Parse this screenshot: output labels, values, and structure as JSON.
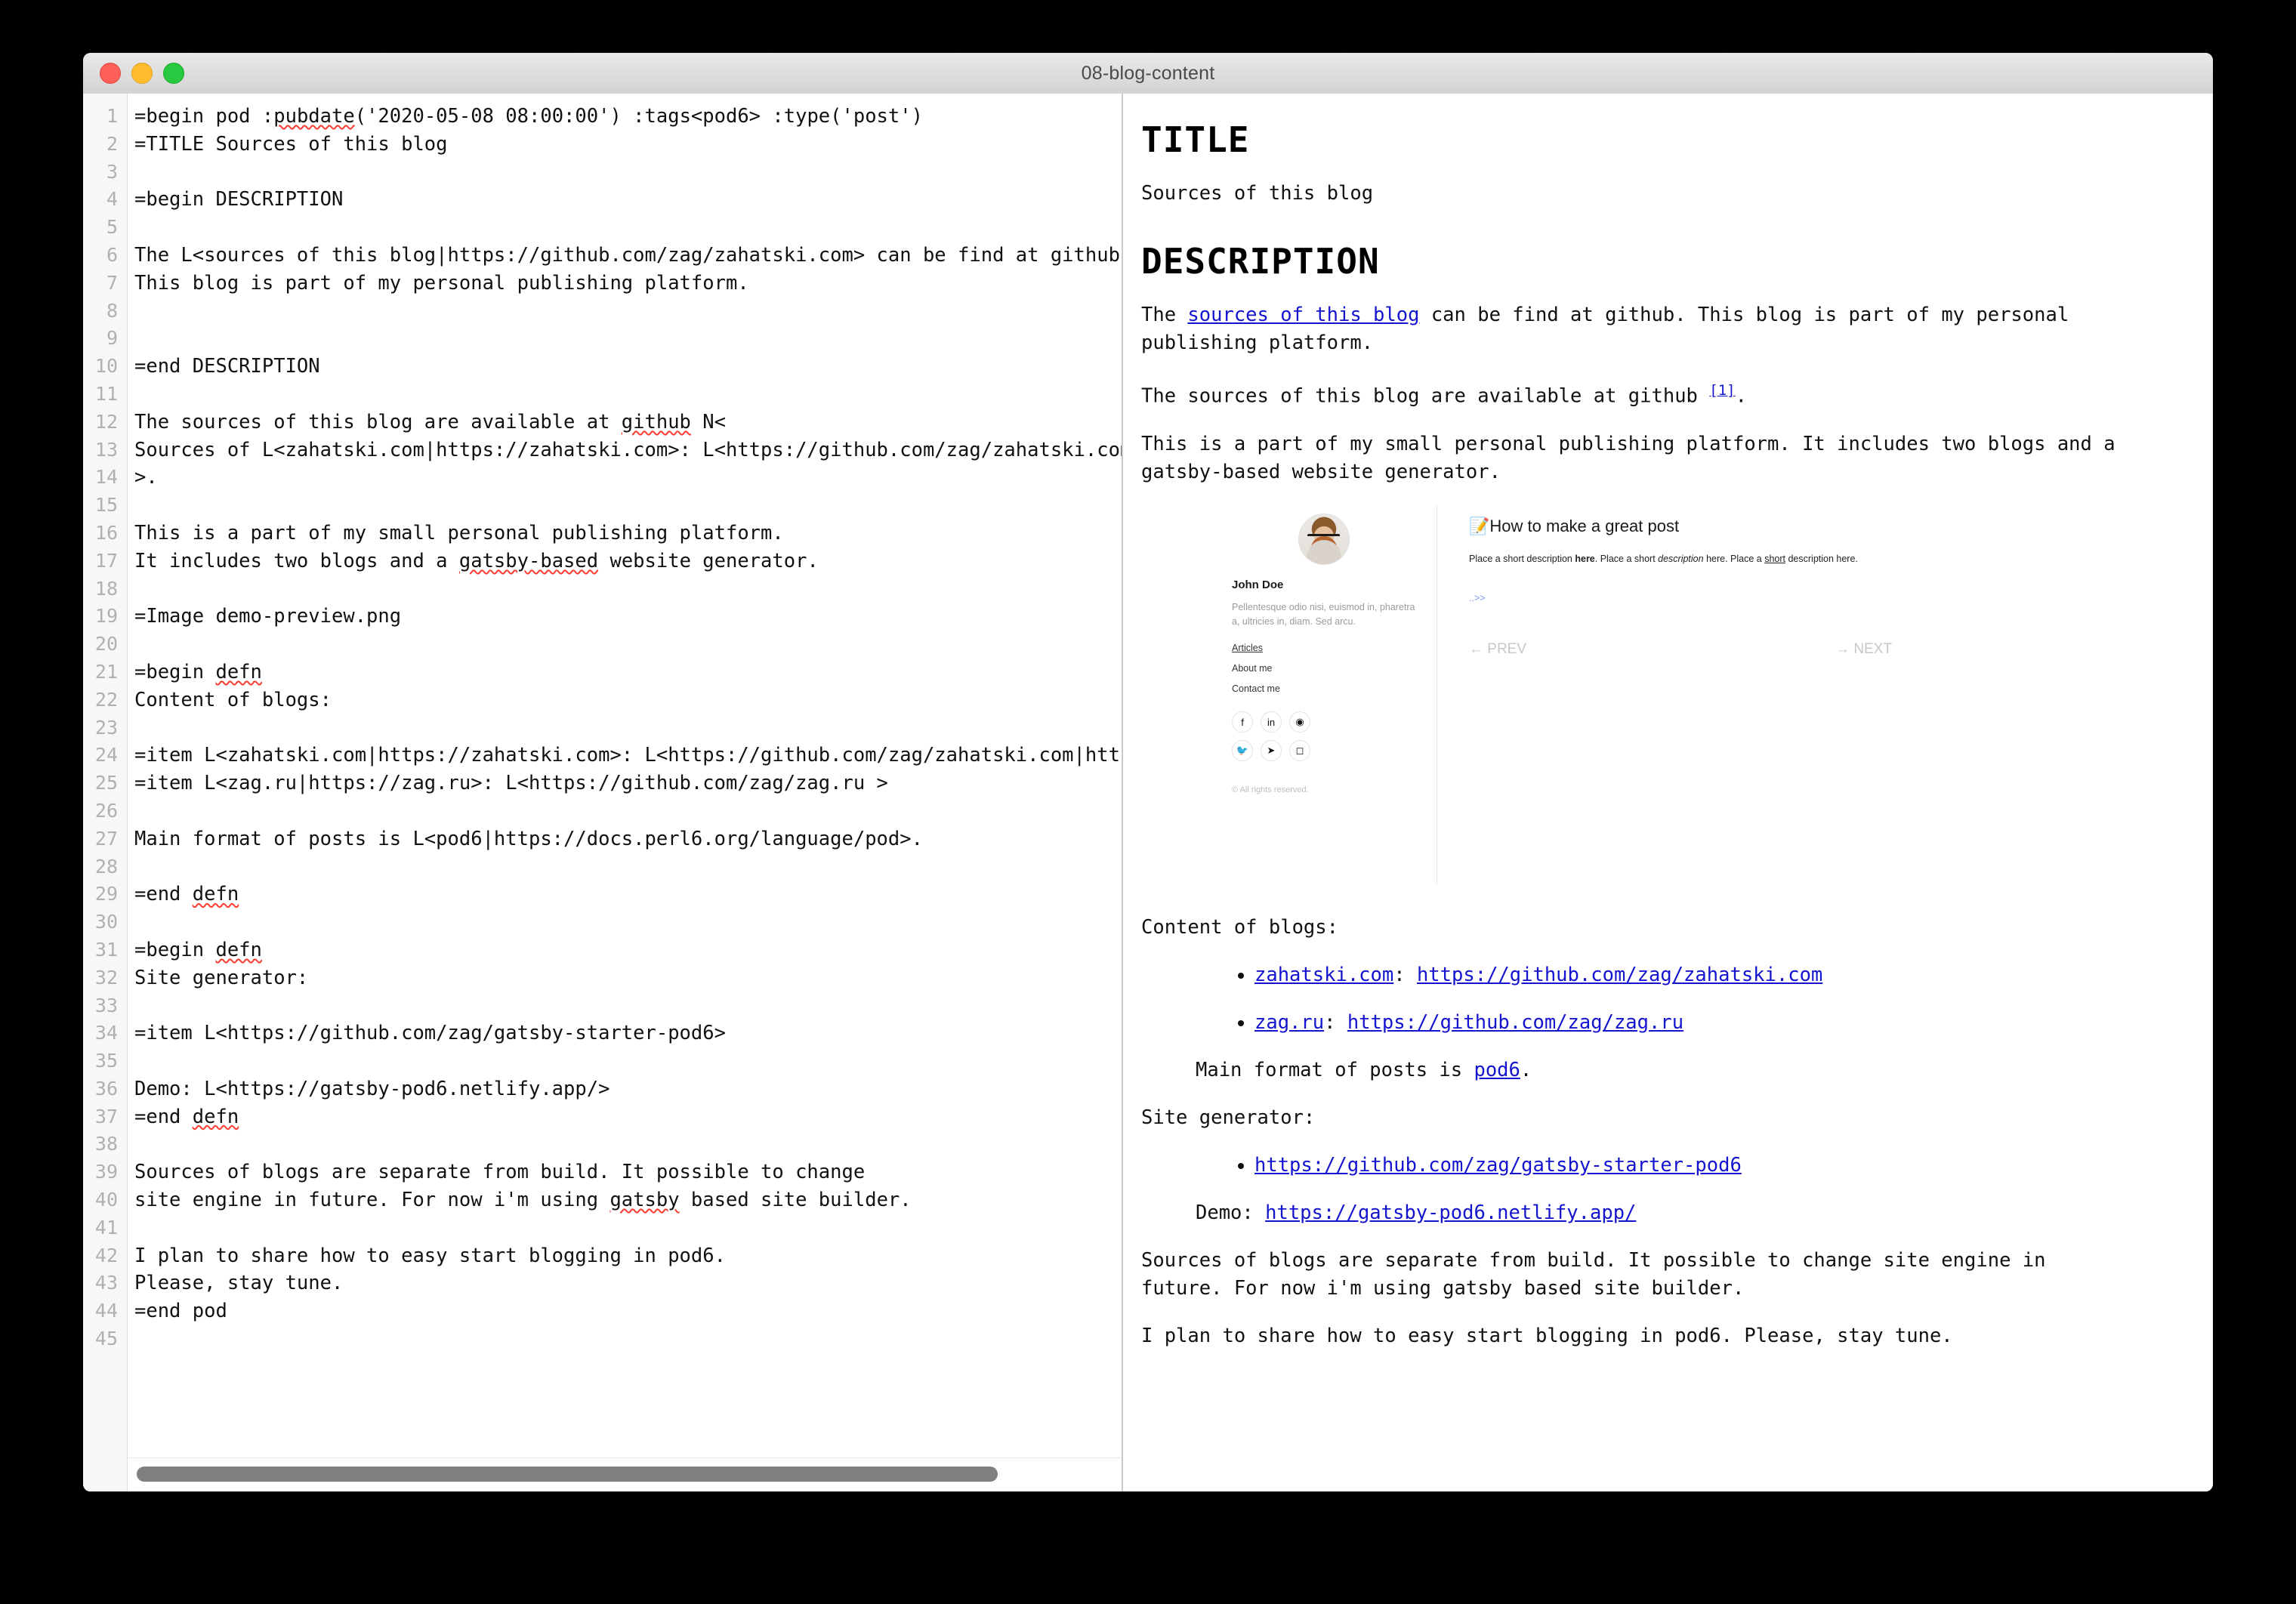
{
  "window": {
    "title": "08-blog-content",
    "traffic_lights": [
      "close",
      "minimize",
      "zoom"
    ]
  },
  "editor": {
    "lines": [
      {
        "n": "1",
        "pre": "=begin pod :",
        "sp": "pubdate",
        "post": "('2020-05-08 08:00:00') :tags<pod6> :type('post')"
      },
      {
        "n": "2",
        "pre": "=TITLE Sources of this blog",
        "sp": "",
        "post": ""
      },
      {
        "n": "3",
        "pre": "",
        "sp": "",
        "post": ""
      },
      {
        "n": "4",
        "pre": "=begin DESCRIPTION",
        "sp": "",
        "post": ""
      },
      {
        "n": "5",
        "pre": "",
        "sp": "",
        "post": ""
      },
      {
        "n": "6",
        "pre": "The L<sources of this blog|https://github.com/zag/zahatski.com> can be find at github.",
        "sp": "",
        "post": ""
      },
      {
        "n": "7",
        "pre": "This blog is part of my personal publishing platform.",
        "sp": "",
        "post": ""
      },
      {
        "n": "8",
        "pre": "",
        "sp": "",
        "post": ""
      },
      {
        "n": "9",
        "pre": "",
        "sp": "",
        "post": ""
      },
      {
        "n": "10",
        "pre": "=end DESCRIPTION",
        "sp": "",
        "post": ""
      },
      {
        "n": "11",
        "pre": "",
        "sp": "",
        "post": ""
      },
      {
        "n": "12",
        "pre": "The sources of this blog are available at ",
        "sp": "github",
        "post": " N<"
      },
      {
        "n": "13",
        "pre": "Sources of L<zahatski.com|https://zahatski.com>: L<https://github.com/zag/zahatski.com|https://github.com/zag/zahatski.com",
        "sp": "",
        "post": ""
      },
      {
        "n": "14",
        "pre": ">.",
        "sp": "",
        "post": ""
      },
      {
        "n": "15",
        "pre": "",
        "sp": "",
        "post": ""
      },
      {
        "n": "16",
        "pre": "This is a part of my small personal publishing platform.",
        "sp": "",
        "post": ""
      },
      {
        "n": "17",
        "pre": "It includes two blogs and a ",
        "sp": "gatsby-based",
        "post": " website generator."
      },
      {
        "n": "18",
        "pre": "",
        "sp": "",
        "post": ""
      },
      {
        "n": "19",
        "pre": "=Image demo-preview.png",
        "sp": "",
        "post": ""
      },
      {
        "n": "20",
        "pre": "",
        "sp": "",
        "post": ""
      },
      {
        "n": "21",
        "pre": "=begin ",
        "sp": "defn",
        "post": ""
      },
      {
        "n": "22",
        "pre": "Content of blogs:",
        "sp": "",
        "post": ""
      },
      {
        "n": "23",
        "pre": "",
        "sp": "",
        "post": ""
      },
      {
        "n": "24",
        "pre": "=item L<zahatski.com|https://zahatski.com>: L<https://github.com/zag/zahatski.com|https://github.com/zag/zahatski.com>",
        "sp": "",
        "post": ""
      },
      {
        "n": "25",
        "pre": "=item L<zag.ru|https://zag.ru>: L<https://github.com/zag/zag.ru >",
        "sp": "",
        "post": ""
      },
      {
        "n": "26",
        "pre": "",
        "sp": "",
        "post": ""
      },
      {
        "n": "27",
        "pre": "Main format of posts is L<pod6|https://docs.perl6.org/language/pod>.",
        "sp": "",
        "post": ""
      },
      {
        "n": "28",
        "pre": "",
        "sp": "",
        "post": ""
      },
      {
        "n": "29",
        "pre": "=end ",
        "sp": "defn",
        "post": ""
      },
      {
        "n": "30",
        "pre": "",
        "sp": "",
        "post": ""
      },
      {
        "n": "31",
        "pre": "=begin ",
        "sp": "defn",
        "post": ""
      },
      {
        "n": "32",
        "pre": "Site generator:",
        "sp": "",
        "post": ""
      },
      {
        "n": "33",
        "pre": "",
        "sp": "",
        "post": ""
      },
      {
        "n": "34",
        "pre": "=item L<https://github.com/zag/gatsby-starter-pod6>",
        "sp": "",
        "post": ""
      },
      {
        "n": "35",
        "pre": "",
        "sp": "",
        "post": ""
      },
      {
        "n": "36",
        "pre": "Demo: L<https://gatsby-pod6.netlify.app/>",
        "sp": "",
        "post": ""
      },
      {
        "n": "37",
        "pre": "=end ",
        "sp": "defn",
        "post": ""
      },
      {
        "n": "38",
        "pre": "",
        "sp": "",
        "post": ""
      },
      {
        "n": "39",
        "pre": "Sources of blogs are separate from build. It possible to change",
        "sp": "",
        "post": ""
      },
      {
        "n": "40",
        "pre": "site engine in future. For now i'm using ",
        "sp": "gatsby",
        "post": " based site builder."
      },
      {
        "n": "41",
        "pre": "",
        "sp": "",
        "post": ""
      },
      {
        "n": "42",
        "pre": "I plan to share how to easy start blogging in pod6.",
        "sp": "",
        "post": ""
      },
      {
        "n": "43",
        "pre": "Please, stay tune.",
        "sp": "",
        "post": ""
      },
      {
        "n": "44",
        "pre": "=end pod",
        "sp": "",
        "post": ""
      },
      {
        "n": "45",
        "pre": "",
        "sp": "",
        "post": ""
      }
    ]
  },
  "preview": {
    "title_heading": "TITLE",
    "title_text": "Sources of this blog",
    "description_heading": "DESCRIPTION",
    "para1": {
      "before": "The ",
      "link": "sources of this blog",
      "after": " can be find at github. This blog is part of my personal publishing platform."
    },
    "para2": {
      "text": "The sources of this blog are available at github ",
      "footnote": "[1]",
      "tail": "."
    },
    "para3": "This is a part of my small personal publishing platform. It includes two blogs and a gatsby-based website generator.",
    "content_heading": "Content of blogs:",
    "blog_items": [
      {
        "name": "zahatski.com",
        "sep": ": ",
        "url": "https://github.com/zag/zahatski.com"
      },
      {
        "name": "zag.ru",
        "sep": ": ",
        "url": "https://github.com/zag/zag.ru"
      }
    ],
    "main_format": {
      "before": "Main format of posts is ",
      "link": "pod6",
      "after": "."
    },
    "site_generator_heading": "Site generator:",
    "generator_items": [
      {
        "url": "https://github.com/zag/gatsby-starter-pod6"
      }
    ],
    "demo_line": {
      "before": "Demo: ",
      "link": "https://gatsby-pod6.netlify.app/"
    },
    "para4": "Sources of blogs are separate from build. It possible to change site engine in future. For now i'm using gatsby based site builder.",
    "para5": "I plan to share how to easy start blogging in pod6. Please, stay tune."
  },
  "demo_image": {
    "profile": {
      "name": "John Doe",
      "bio": "Pellentesque odio nisi, euismod in, pharetra a, ultricies in, diam. Sed arcu.",
      "nav": [
        "Articles",
        "About me",
        "Contact me"
      ],
      "social_row1": [
        "facebook-icon",
        "linkedin-icon",
        "github-icon"
      ],
      "social_row2": [
        "twitter-icon",
        "telegram-icon",
        "instagram-icon"
      ],
      "social_glyphs_row1": [
        "f",
        "in",
        "◉"
      ],
      "social_glyphs_row2": [
        "🐦",
        "➤",
        "◻"
      ],
      "copyright": "© All rights reserved."
    },
    "post": {
      "emoji": "📝",
      "title": "How to make a great post",
      "desc_1": "Place a short description ",
      "desc_bold": "here",
      "desc_2": ". Place a short ",
      "desc_italic": "description",
      "desc_3": " here. Place a ",
      "desc_underline": "short",
      "desc_4": " description here.",
      "more": "..>>",
      "prev": "← PREV",
      "next": "→ NEXT"
    }
  },
  "colors": {
    "link": "#1414cf",
    "spellcheck": "#ff3b30",
    "titlebar": "#e0e0e0"
  }
}
